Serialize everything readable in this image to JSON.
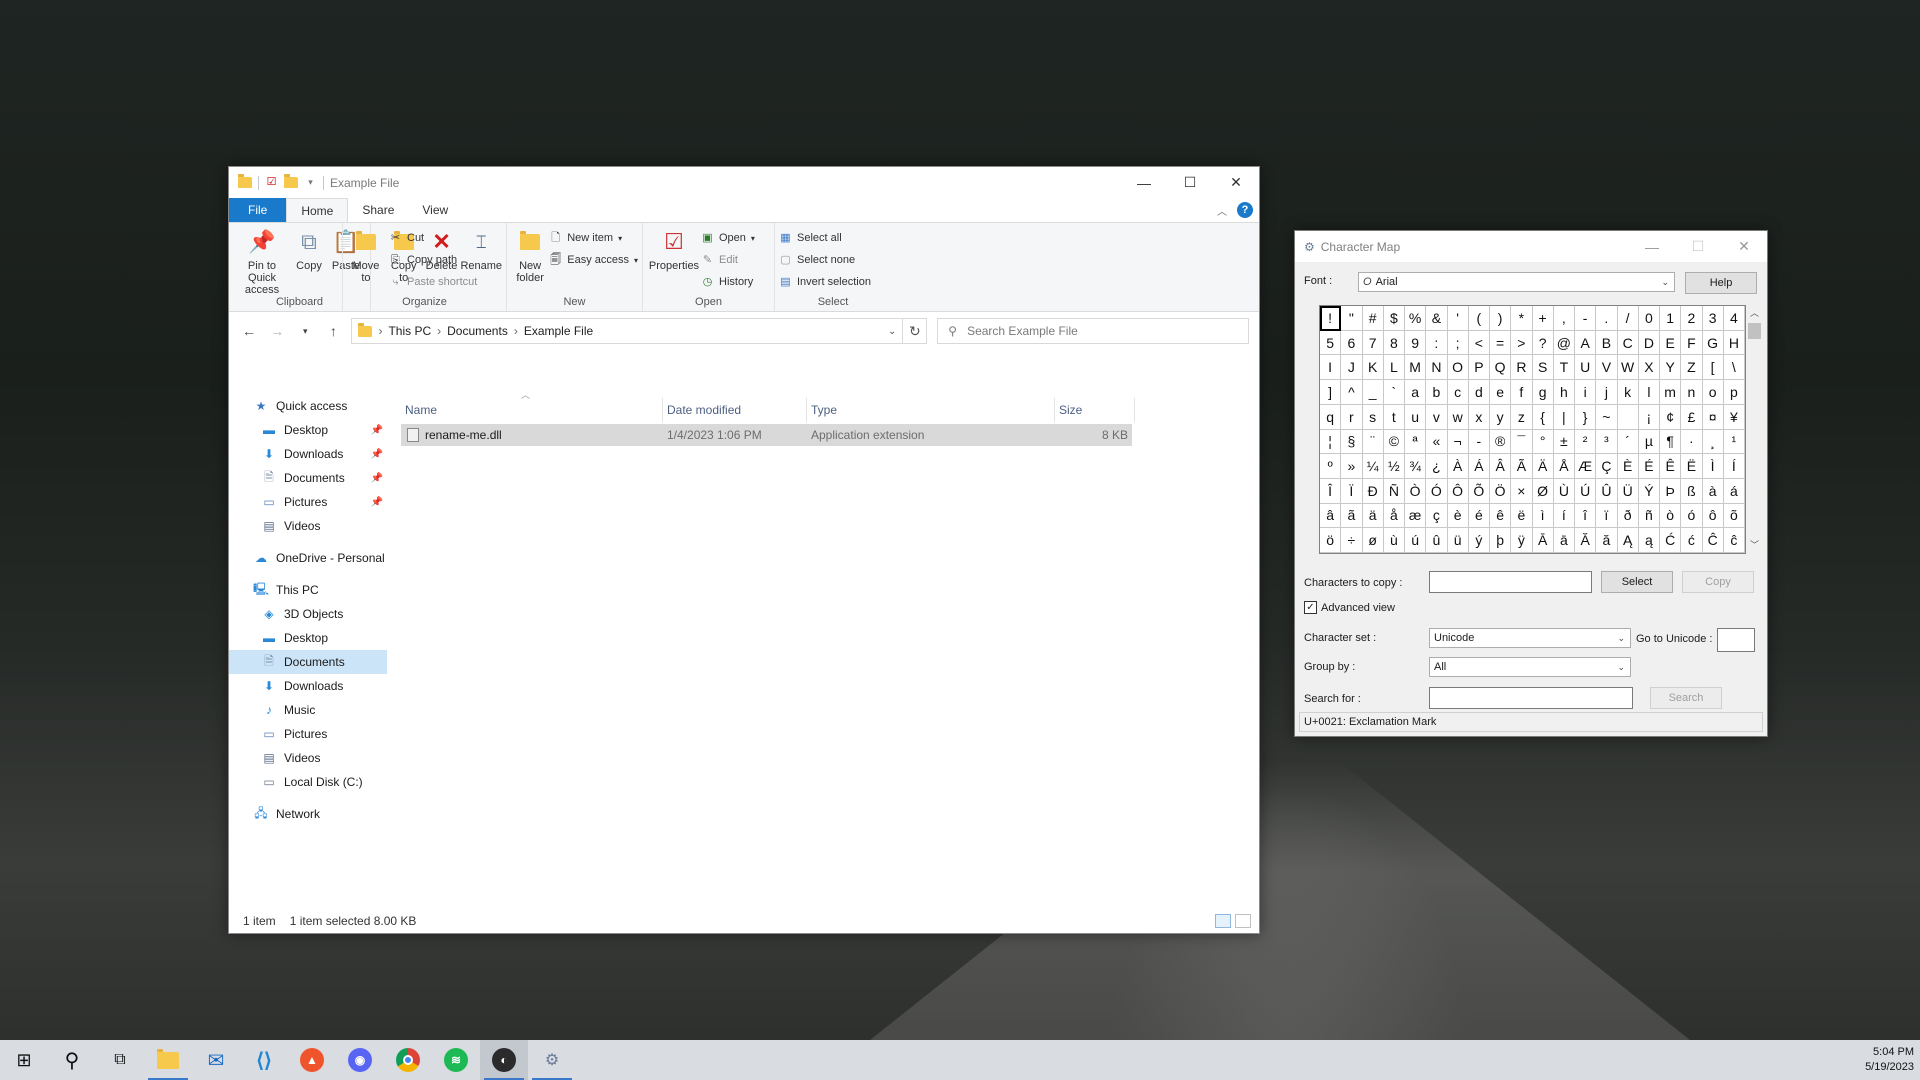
{
  "explorer": {
    "title": "Example File",
    "tabs": [
      "File",
      "Home",
      "Share",
      "View"
    ],
    "active_tab": "Home",
    "ribbon": {
      "clipboard": {
        "label": "Clipboard",
        "pin": "Pin to Quick access",
        "copy": "Copy",
        "paste": "Paste",
        "cut": "Cut",
        "copy_path": "Copy path",
        "paste_shortcut": "Paste shortcut"
      },
      "organize": {
        "label": "Organize",
        "move_to": "Move to",
        "copy_to": "Copy to",
        "delete": "Delete",
        "rename": "Rename"
      },
      "new": {
        "label": "New",
        "new_folder": "New folder",
        "new_item": "New item",
        "easy_access": "Easy access"
      },
      "open": {
        "label": "Open",
        "properties": "Properties",
        "open": "Open",
        "edit": "Edit",
        "history": "History"
      },
      "select": {
        "label": "Select",
        "select_all": "Select all",
        "select_none": "Select none",
        "invert": "Invert selection"
      }
    },
    "breadcrumb": [
      "This PC",
      "Documents",
      "Example File"
    ],
    "search_placeholder": "Search Example File",
    "nav": {
      "quick_access": "Quick access",
      "quick_items": [
        "Desktop",
        "Downloads",
        "Documents",
        "Pictures",
        "Videos"
      ],
      "onedrive": "OneDrive - Personal",
      "this_pc": "This PC",
      "pc_items": [
        "3D Objects",
        "Desktop",
        "Documents",
        "Downloads",
        "Music",
        "Pictures",
        "Videos",
        "Local Disk (C:)"
      ],
      "network": "Network"
    },
    "columns": [
      "Name",
      "Date modified",
      "Type",
      "Size"
    ],
    "files": [
      {
        "name": "rename-me.dll",
        "date": "1/4/2023 1:06 PM",
        "type": "Application extension",
        "size": "8 KB"
      }
    ],
    "status": {
      "count": "1 item",
      "selected": "1 item selected  8.00 KB"
    }
  },
  "charmap": {
    "title": "Character Map",
    "font_label": "Font :",
    "font_value": "Arial",
    "help": "Help",
    "grid_rows": [
      [
        "!",
        "\"",
        "#",
        "$",
        "%",
        "&",
        "'",
        "(",
        ")",
        "*",
        "+",
        ",",
        "-",
        ".",
        "/",
        "0",
        "1",
        "2",
        "3",
        "4"
      ],
      [
        "5",
        "6",
        "7",
        "8",
        "9",
        ":",
        ";",
        "<",
        "=",
        ">",
        "?",
        "@",
        "A",
        "B",
        "C",
        "D",
        "E",
        "F",
        "G",
        "H"
      ],
      [
        "I",
        "J",
        "K",
        "L",
        "M",
        "N",
        "O",
        "P",
        "Q",
        "R",
        "S",
        "T",
        "U",
        "V",
        "W",
        "X",
        "Y",
        "Z",
        "[",
        "\\"
      ],
      [
        "]",
        "^",
        "_",
        "`",
        "a",
        "b",
        "c",
        "d",
        "e",
        "f",
        "g",
        "h",
        "i",
        "j",
        "k",
        "l",
        "m",
        "n",
        "o",
        "p"
      ],
      [
        "q",
        "r",
        "s",
        "t",
        "u",
        "v",
        "w",
        "x",
        "y",
        "z",
        "{",
        "|",
        "}",
        "~",
        " ",
        "¡",
        "¢",
        "£",
        "¤",
        "¥"
      ],
      [
        "¦",
        "§",
        "¨",
        "©",
        "ª",
        "«",
        "¬",
        "-",
        "®",
        "¯",
        "°",
        "±",
        "²",
        "³",
        "´",
        "µ",
        "¶",
        "·",
        "¸",
        "¹"
      ],
      [
        "º",
        "»",
        "¼",
        "½",
        "¾",
        "¿",
        "À",
        "Á",
        "Â",
        "Ã",
        "Ä",
        "Å",
        "Æ",
        "Ç",
        "È",
        "É",
        "Ê",
        "Ë",
        "Ì",
        "Í"
      ],
      [
        "Î",
        "Ï",
        "Ð",
        "Ñ",
        "Ò",
        "Ó",
        "Ô",
        "Õ",
        "Ö",
        "×",
        "Ø",
        "Ù",
        "Ú",
        "Û",
        "Ü",
        "Ý",
        "Þ",
        "ß",
        "à",
        "á"
      ],
      [
        "â",
        "ã",
        "ä",
        "å",
        "æ",
        "ç",
        "è",
        "é",
        "ê",
        "ë",
        "ì",
        "í",
        "î",
        "ï",
        "ð",
        "ñ",
        "ò",
        "ó",
        "ô",
        "õ"
      ],
      [
        "ö",
        "÷",
        "ø",
        "ù",
        "ú",
        "û",
        "ü",
        "ý",
        "þ",
        "ÿ",
        "Ā",
        "ā",
        "Ă",
        "ă",
        "Ą",
        "ą",
        "Ć",
        "ć",
        "Ĉ",
        "ĉ"
      ]
    ],
    "chars_to_copy_label": "Characters to copy :",
    "chars_to_copy_value": "",
    "select": "Select",
    "copy": "Copy",
    "advanced_view": "Advanced view",
    "advanced_checked": true,
    "charset_label": "Character set :",
    "charset_value": "Unicode",
    "goto_unicode_label": "Go to Unicode :",
    "groupby_label": "Group by :",
    "groupby_value": "All",
    "search_label": "Search for :",
    "search": "Search",
    "status": "U+0021: Exclamation Mark"
  },
  "taskbar": {
    "time": "5:04 PM",
    "date": "5/19/2023",
    "icons": [
      "windows-start-icon",
      "search-icon",
      "task-view-icon",
      "file-explorer-icon",
      "mail-icon",
      "vscode-icon",
      "brave-icon",
      "discord-icon",
      "chrome-icon",
      "spotify-icon",
      "obs-icon",
      "character-map-icon"
    ]
  }
}
